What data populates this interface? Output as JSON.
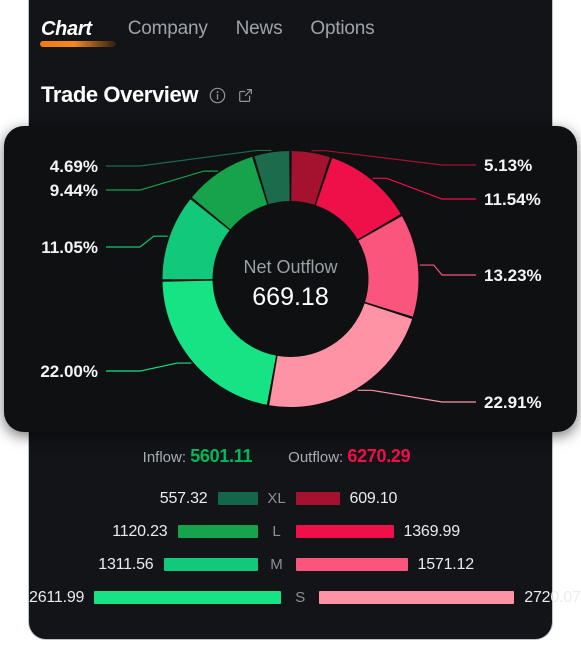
{
  "nav": {
    "brand": "Chart",
    "links": [
      "Company",
      "News",
      "Options"
    ]
  },
  "header": {
    "title": "Trade Overview",
    "info_icon": "info-circle-icon",
    "share_icon": "share-export-icon"
  },
  "donut": {
    "center_label": "Net Outflow",
    "center_value": "669.18"
  },
  "totals": {
    "inflow_label": "Inflow:",
    "inflow_value": "5601.11",
    "inflow_color": "#00b85a",
    "outflow_label": "Outflow:",
    "outflow_value": "6270.29",
    "outflow_color": "#ee0f49"
  },
  "chart_data": {
    "type": "pie",
    "title": "Trade Overview",
    "center_label": "Net Outflow",
    "center_value": 669.18,
    "grid": false,
    "legend": "leader-lines",
    "rotation_deg": 0,
    "inflow_total": 5601.11,
    "outflow_total": 6270.29,
    "categories": [
      "XL",
      "L",
      "M",
      "S"
    ],
    "series": [
      {
        "name": "Inflow",
        "values": [
          557.32,
          1120.23,
          1311.56,
          2611.99
        ]
      },
      {
        "name": "Outflow",
        "values": [
          609.1,
          1369.99,
          1571.12,
          2720.07
        ]
      }
    ],
    "slices": [
      {
        "label": "5.13%",
        "pct": 5.13,
        "value": 609.1,
        "side": "outflow",
        "category": "XL",
        "color": "#a5122f"
      },
      {
        "label": "11.54%",
        "pct": 11.54,
        "value": 1369.99,
        "side": "outflow",
        "category": "L",
        "color": "#ef0f49"
      },
      {
        "label": "13.23%",
        "pct": 13.23,
        "value": 1571.12,
        "side": "outflow",
        "category": "M",
        "color": "#fa567d"
      },
      {
        "label": "22.91%",
        "pct": 22.91,
        "value": 2720.07,
        "side": "outflow",
        "category": "S",
        "color": "#fd93a5"
      },
      {
        "label": "22.00%",
        "pct": 22.0,
        "value": 2611.99,
        "side": "inflow",
        "category": "S",
        "color": "#16e384"
      },
      {
        "label": "11.05%",
        "pct": 11.05,
        "value": 1311.56,
        "side": "inflow",
        "category": "M",
        "color": "#12c87a"
      },
      {
        "label": "9.44%",
        "pct": 9.44,
        "value": 1120.23,
        "side": "inflow",
        "category": "L",
        "color": "#16a34c"
      },
      {
        "label": "4.69%",
        "pct": 4.69,
        "value": 557.32,
        "side": "inflow",
        "category": "XL",
        "color": "#1c6b4d"
      }
    ],
    "labels_left": [
      "4.69%",
      "9.44%",
      "11.05%",
      "22.00%"
    ],
    "labels_right": [
      "5.13%",
      "11.54%",
      "13.23%",
      "22.91%"
    ]
  },
  "bars": [
    {
      "category": "XL",
      "inflow_value": "557.32",
      "inflow_width": 40,
      "inflow_color": "#14664a",
      "outflow_value": "609.10",
      "outflow_width": 44,
      "outflow_color": "#a5122f"
    },
    {
      "category": "L",
      "inflow_value": "1120.23",
      "inflow_width": 80,
      "inflow_color": "#16a34c",
      "outflow_value": "1369.99",
      "outflow_width": 98,
      "outflow_color": "#ef0f49"
    },
    {
      "category": "M",
      "inflow_value": "1311.56",
      "inflow_width": 94,
      "inflow_color": "#12c87a",
      "outflow_value": "1571.12",
      "outflow_width": 112,
      "outflow_color": "#fa567d"
    },
    {
      "category": "S",
      "inflow_value": "2611.99",
      "inflow_width": 187,
      "inflow_color": "#16e384",
      "outflow_value": "2720.07",
      "outflow_width": 195,
      "outflow_color": "#fd93a5"
    }
  ]
}
